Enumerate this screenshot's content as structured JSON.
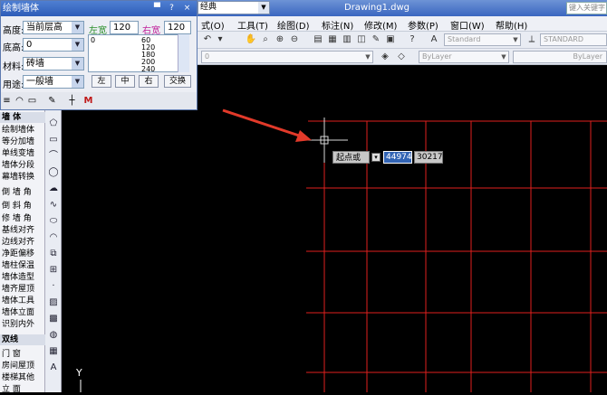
{
  "app": {
    "doc_title": "Drawing1.dwg",
    "search_placeholder": "键入关键字",
    "style_combo": "经典"
  },
  "menubar": {
    "items": [
      "式(O)",
      "工具(T)",
      "绘图(D)",
      "标注(N)",
      "修改(M)",
      "参数(P)",
      "窗口(W)",
      "帮助(H)"
    ]
  },
  "toolbar": {
    "text_style": "Standard",
    "dim_style": "STANDARD",
    "layer_value": "0",
    "color_value": "ByLayer",
    "linetype_value": "ByLayer"
  },
  "dialog": {
    "title": "绘制墙体",
    "height_label": "高度:",
    "height_value": "当前层高",
    "bottom_label": "底高:",
    "bottom_value": "0",
    "material_label": "材料:",
    "material_value": "砖墙",
    "usage_label": "用途:",
    "usage_value": "一般墙",
    "left_width_label": "左宽",
    "left_width_value": "120",
    "right_width_label": "右宽",
    "right_width_value": "120",
    "list_left": [
      "0"
    ],
    "list_values": [
      "60",
      "120",
      "180",
      "200",
      "240"
    ],
    "btn_left": "左",
    "btn_center": "中",
    "btn_right": "右",
    "btn_swap": "交换"
  },
  "palette": {
    "header": "墙    体",
    "items": [
      "绘制墙体",
      "等分加墙",
      "单线变墙",
      "墙体分段",
      "幕墙转换",
      "倒 墙 角",
      "倒 斜 角",
      "修 墙 角",
      "基线对齐",
      "边线对齐",
      "净距偏移",
      "墙柱保温",
      "墙体造型",
      "墙齐屋顶",
      "墙体工具",
      "墙体立面",
      "识别内外"
    ],
    "footer_items": [
      "双线",
      "门    窗",
      "房间屋顶",
      "楼梯其他",
      "立    面"
    ]
  },
  "canvas": {
    "prompt_label": "起点或",
    "x_value": "44974",
    "y_value": "30217",
    "ucs_label": "Y"
  },
  "colors": {
    "grid_line": "#e0201e",
    "arrow": "#e23a2a",
    "crosshair": "#d8d8d8",
    "background": "#000000"
  }
}
